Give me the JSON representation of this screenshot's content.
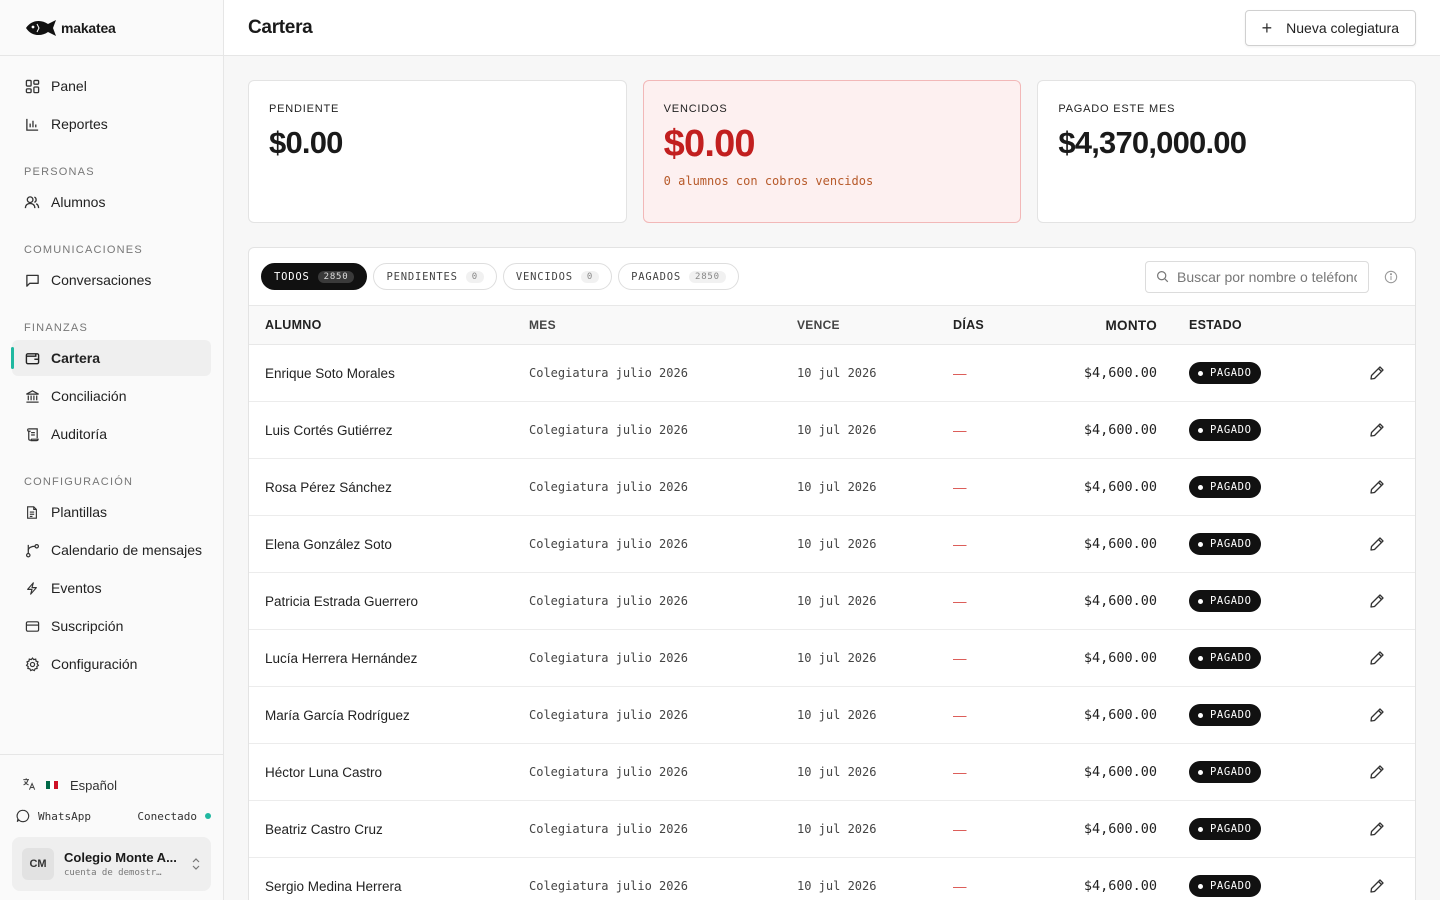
{
  "brand": {
    "name": "makatea"
  },
  "sidebar": {
    "top_items": [
      {
        "label": "Panel",
        "icon": "grid-icon"
      },
      {
        "label": "Reportes",
        "icon": "bar-chart-icon"
      }
    ],
    "sections": [
      {
        "title": "PERSONAS",
        "items": [
          {
            "label": "Alumnos",
            "icon": "users-icon"
          }
        ]
      },
      {
        "title": "COMUNICACIONES",
        "items": [
          {
            "label": "Conversaciones",
            "icon": "chat-icon"
          }
        ]
      },
      {
        "title": "FINANZAS",
        "items": [
          {
            "label": "Cartera",
            "icon": "wallet-icon",
            "active": true
          },
          {
            "label": "Conciliación",
            "icon": "bank-icon"
          },
          {
            "label": "Auditoría",
            "icon": "scroll-icon"
          }
        ]
      },
      {
        "title": "CONFIGURACIÓN",
        "items": [
          {
            "label": "Plantillas",
            "icon": "document-icon"
          },
          {
            "label": "Calendario de mensajes",
            "icon": "workflow-icon"
          },
          {
            "label": "Eventos",
            "icon": "bolt-icon"
          },
          {
            "label": "Suscripción",
            "icon": "credit-card-icon"
          },
          {
            "label": "Configuración",
            "icon": "gear-icon"
          }
        ]
      }
    ],
    "footer": {
      "language": "Español",
      "whatsapp_label": "WhatsApp",
      "whatsapp_status": "Conectado",
      "account_initials": "CM",
      "account_name": "Colegio Monte A...",
      "account_sub": "cuenta de demostr…"
    }
  },
  "header": {
    "title": "Cartera",
    "new_button": "Nueva colegiatura"
  },
  "cards": [
    {
      "label": "PENDIENTE",
      "value": "$0.00",
      "note": ""
    },
    {
      "label": "VENCIDOS",
      "value": "$0.00",
      "note": "0 alumnos con cobros vencidos"
    },
    {
      "label": "PAGADO ESTE MES",
      "value": "$4,370,000.00",
      "note": ""
    }
  ],
  "filters": [
    {
      "label": "TODOS",
      "count": "2850",
      "active": true
    },
    {
      "label": "PENDIENTES",
      "count": "0"
    },
    {
      "label": "VENCIDOS",
      "count": "0"
    },
    {
      "label": "PAGADOS",
      "count": "2850"
    }
  ],
  "search": {
    "placeholder": "Buscar por nombre o teléfono"
  },
  "table": {
    "columns": [
      "ALUMNO",
      "MES",
      "VENCE",
      "DÍAS",
      "MONTO",
      "ESTADO"
    ],
    "rows": [
      {
        "alumno": "Enrique Soto Morales",
        "mes": "Colegiatura julio 2026",
        "vence": "10 jul 2026",
        "dias": "—",
        "monto": "$4,600.00",
        "estado": "PAGADO"
      },
      {
        "alumno": "Luis Cortés Gutiérrez",
        "mes": "Colegiatura julio 2026",
        "vence": "10 jul 2026",
        "dias": "—",
        "monto": "$4,600.00",
        "estado": "PAGADO"
      },
      {
        "alumno": "Rosa Pérez Sánchez",
        "mes": "Colegiatura julio 2026",
        "vence": "10 jul 2026",
        "dias": "—",
        "monto": "$4,600.00",
        "estado": "PAGADO"
      },
      {
        "alumno": "Elena González Soto",
        "mes": "Colegiatura julio 2026",
        "vence": "10 jul 2026",
        "dias": "—",
        "monto": "$4,600.00",
        "estado": "PAGADO"
      },
      {
        "alumno": "Patricia Estrada Guerrero",
        "mes": "Colegiatura julio 2026",
        "vence": "10 jul 2026",
        "dias": "—",
        "monto": "$4,600.00",
        "estado": "PAGADO"
      },
      {
        "alumno": "Lucía Herrera Hernández",
        "mes": "Colegiatura julio 2026",
        "vence": "10 jul 2026",
        "dias": "—",
        "monto": "$4,600.00",
        "estado": "PAGADO"
      },
      {
        "alumno": "María García Rodríguez",
        "mes": "Colegiatura julio 2026",
        "vence": "10 jul 2026",
        "dias": "—",
        "monto": "$4,600.00",
        "estado": "PAGADO"
      },
      {
        "alumno": "Héctor Luna Castro",
        "mes": "Colegiatura julio 2026",
        "vence": "10 jul 2026",
        "dias": "—",
        "monto": "$4,600.00",
        "estado": "PAGADO"
      },
      {
        "alumno": "Beatriz Castro Cruz",
        "mes": "Colegiatura julio 2026",
        "vence": "10 jul 2026",
        "dias": "—",
        "monto": "$4,600.00",
        "estado": "PAGADO"
      },
      {
        "alumno": "Sergio Medina Herrera",
        "mes": "Colegiatura julio 2026",
        "vence": "10 jul 2026",
        "dias": "—",
        "monto": "$4,600.00",
        "estado": "PAGADO"
      }
    ]
  },
  "colors": {
    "accent": "#20b8a0",
    "danger": "#c21f1f",
    "danger_bg": "#fdf0f0",
    "badge_bg": "#111111"
  }
}
